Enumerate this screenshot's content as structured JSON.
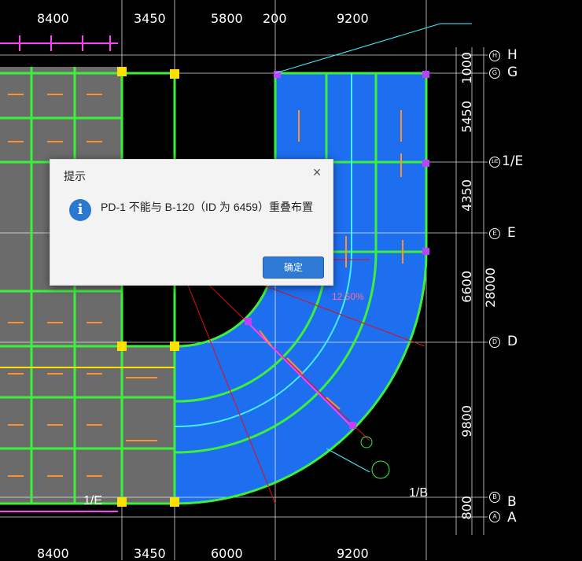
{
  "dialog": {
    "title": "提示",
    "message": "PD-1 不能与 B-120（ID 为 6459）重叠布置",
    "ok_label": "确定",
    "close_glyph": "×",
    "info_glyph": "i",
    "icon": "info-icon"
  },
  "dimensions_top": [
    "8400",
    "3450",
    "5800",
    "200",
    "9200"
  ],
  "dimensions_bottom": [
    "8400",
    "3450",
    "6000",
    "9200"
  ],
  "dimensions_right": [
    "1000",
    "5450",
    "4350",
    "6600",
    "9800",
    "800"
  ],
  "total_right": "28000",
  "axes_right": [
    {
      "label": "H",
      "circle": "H"
    },
    {
      "label": "G",
      "circle": "G"
    },
    {
      "label": "1/E",
      "circle": "1/E"
    },
    {
      "label": "E",
      "circle": "E"
    },
    {
      "label": "D",
      "circle": "D"
    },
    {
      "label": "B",
      "circle": "B"
    },
    {
      "label": "A",
      "circle": "A"
    }
  ],
  "annotations": {
    "slope": "12.50%",
    "axis_1b": "1/B",
    "axis_1e_left": "1/E"
  },
  "colors": {
    "slab": "#1e6ef0",
    "beam": "#3cf03c",
    "grid": "#ffffff",
    "concrete": "#6b6b6b",
    "column": "#ffe000",
    "accent": "#2f7ad6"
  }
}
